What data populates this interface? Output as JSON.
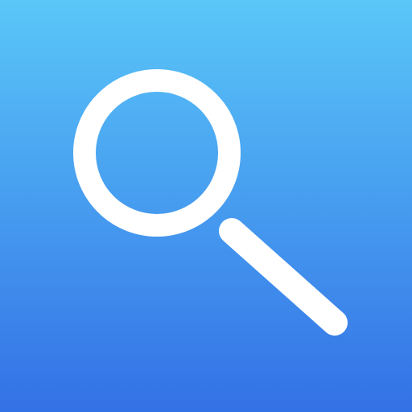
{
  "icon": {
    "name": "search-icon",
    "glyph": "magnifying-glass",
    "colors": {
      "gradient_top": "#5AC7F8",
      "gradient_bottom": "#3371E6",
      "glyph": "#FFFFFF"
    }
  }
}
